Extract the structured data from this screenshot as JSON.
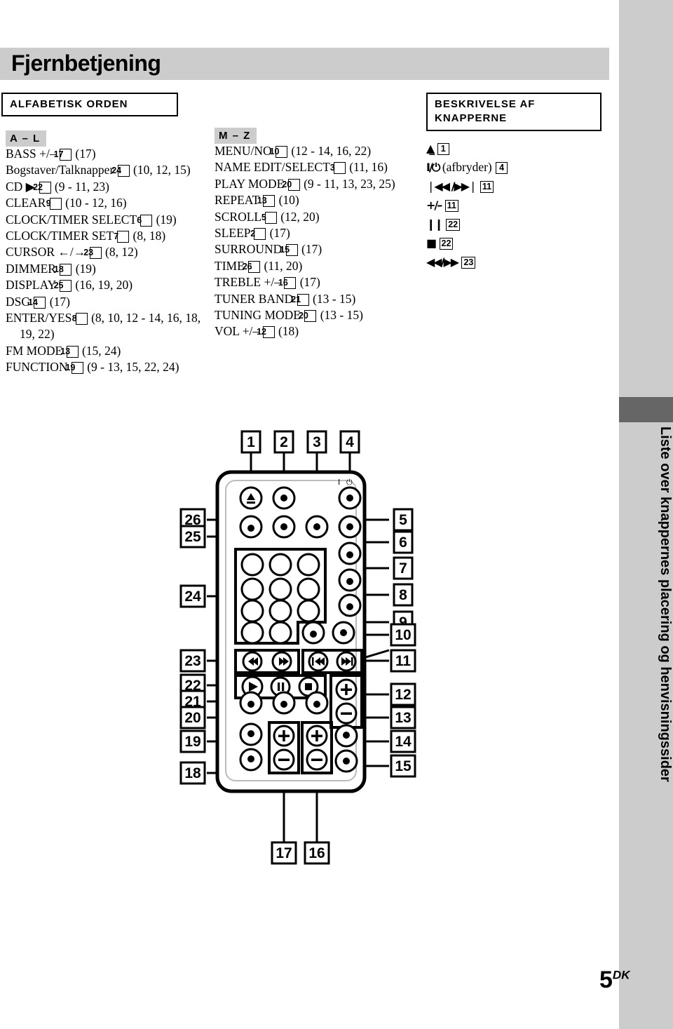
{
  "header": {
    "title": "Fjernbetjening"
  },
  "sections": {
    "alphabetical": "ALFABETISK ORDEN",
    "button_description_line1": "BESKRIVELSE AF",
    "button_description_line2": "KNAPPERNE"
  },
  "tags": {
    "a_l": "A – L",
    "m_z": "M – Z"
  },
  "index_al": [
    {
      "name": "BASS +/–",
      "num": "17",
      "pages": "(17)"
    },
    {
      "name": "Bogstaver/Talknapper",
      "num": "24",
      "pages": "(10, 12, 15)"
    },
    {
      "name": "CD ▶",
      "num": "22",
      "pages": "(9 - 11, 23)"
    },
    {
      "name": "CLEAR",
      "num": "9",
      "pages": "(10 - 12, 16)"
    },
    {
      "name": "CLOCK/TIMER SELECT",
      "num": "6",
      "pages": "(19)"
    },
    {
      "name": "CLOCK/TIMER SET",
      "num": "7",
      "pages": "(8, 18)"
    },
    {
      "name": "CURSOR ←/→",
      "num": "23",
      "pages": "(8, 12)"
    },
    {
      "name": "DIMMER",
      "num": "18",
      "pages": "(19)"
    },
    {
      "name": "DISPLAY",
      "num": "25",
      "pages": "(16, 19, 20)"
    },
    {
      "name": "DSG",
      "num": "14",
      "pages": "(17)"
    },
    {
      "name": "ENTER/YES",
      "num": "8",
      "pages": "(8, 10, 12 - 14, 16, 18, 19, 22)"
    },
    {
      "name": "FM MODE",
      "num": "13",
      "pages": "(15, 24)"
    },
    {
      "name": "FUNCTION",
      "num": "19",
      "pages": "(9 - 13, 15, 22, 24)"
    }
  ],
  "index_mz": [
    {
      "name": "MENU/NO",
      "num": "10",
      "pages": "(12 - 14, 16, 22)"
    },
    {
      "name": "NAME EDIT/SELECT",
      "num": "3",
      "pages": "(11, 16)"
    },
    {
      "name": "PLAY MODE",
      "num": "20",
      "pages": "(9 - 11, 13, 23, 25)"
    },
    {
      "name": "REPEAT",
      "num": "13",
      "pages": "(10)"
    },
    {
      "name": "SCROLL",
      "num": "5",
      "pages": "(12, 20)"
    },
    {
      "name": "SLEEP",
      "num": "2",
      "pages": "(17)"
    },
    {
      "name": "SURROUND",
      "num": "15",
      "pages": "(17)"
    },
    {
      "name": "TIME",
      "num": "26",
      "pages": "(11, 20)"
    },
    {
      "name": "TREBLE +/–",
      "num": "16",
      "pages": "(17)"
    },
    {
      "name": "TUNER BAND",
      "num": "21",
      "pages": "(13 - 15)"
    },
    {
      "name": "TUNING MODE",
      "num": "20",
      "pages": "(13 - 15)"
    },
    {
      "name": "VOL +/–",
      "num": "12",
      "pages": "(18)"
    }
  ],
  "index_desc": [
    {
      "glyph": "▲̲",
      "icon": "eject-icon",
      "name": "",
      "num": "1",
      "pages": ""
    },
    {
      "glyph": "I/⏻",
      "icon": "power-icon",
      "name": "(afbryder)",
      "num": "4",
      "pages": ""
    },
    {
      "glyph": "❘◀◀ /▶▶❘",
      "icon": "prev-next-track-icon",
      "name": "",
      "num": "11",
      "pages": ""
    },
    {
      "glyph": "+/–",
      "icon": "plus-minus-icon",
      "name": "",
      "num": "11",
      "pages": ""
    },
    {
      "glyph": "❙❙",
      "icon": "pause-icon",
      "name": "",
      "num": "22",
      "pages": ""
    },
    {
      "glyph": "■",
      "icon": "stop-icon",
      "name": "",
      "num": "22",
      "pages": ""
    },
    {
      "glyph": "◀◀/▶▶",
      "icon": "rewind-forward-icon",
      "name": "",
      "num": "23",
      "pages": ""
    }
  ],
  "diagram": {
    "name": "remote-control-diagram",
    "power_label": "I / ⏻",
    "callouts_top": [
      "1",
      "2",
      "3",
      "4"
    ],
    "callouts_right": [
      "5",
      "6",
      "7",
      "8",
      "9",
      "10",
      "11",
      "12",
      "13",
      "14",
      "15"
    ],
    "callouts_bottom": [
      "17",
      "16"
    ],
    "callouts_left": [
      "26",
      "25",
      "24",
      "23",
      "22",
      "21",
      "20",
      "19",
      "18"
    ],
    "button_glyphs": {
      "eject": "▲",
      "rewind": "◀◀",
      "fast_forward": "▶▶",
      "prev_track": "❘◀◀",
      "next_track": "▶▶❘",
      "play": "▶",
      "pause": "❙❙",
      "stop": "■",
      "plus": "+",
      "minus": "–"
    }
  },
  "sidebar": {
    "vertical_title": "Liste over knappernes placering og henvisningssider"
  },
  "footer": {
    "page_number": "5",
    "page_suffix": "DK"
  },
  "colors": {
    "header_band": "#cccccc",
    "right_margin": "#cccccc",
    "right_tab": "#666666",
    "text": "#000000"
  }
}
